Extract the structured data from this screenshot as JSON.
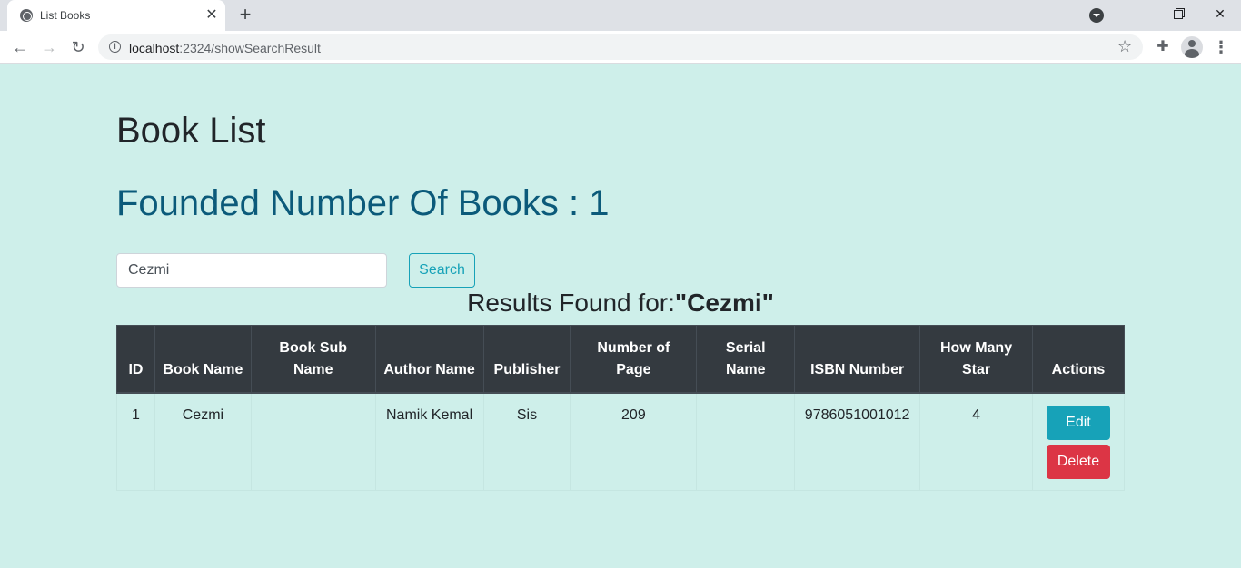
{
  "browser": {
    "tab_title": "List Books",
    "url_host": "localhost",
    "url_path": ":2324/showSearchResult",
    "icons": {
      "favicon": "globe-icon",
      "close": "close-icon",
      "new_tab": "plus-icon",
      "back": "back-arrow-icon",
      "forward": "forward-arrow-icon",
      "reload": "reload-icon",
      "info": "info-icon",
      "bookmark": "star-icon",
      "extensions": "puzzle-icon",
      "profile": "avatar",
      "menu": "kebab-menu-icon"
    }
  },
  "page": {
    "title": "Book List",
    "found_label": "Founded Number Of Books : 1",
    "search": {
      "value": "Cezmi",
      "button_label": "Search"
    },
    "results_prefix": "Results Found for:",
    "results_query": "\"Cezmi\"",
    "table": {
      "headers": [
        "ID",
        "Book Name",
        "Book Sub Name",
        "Author Name",
        "Publisher",
        "Number of Page",
        "Serial Name",
        "ISBN Number",
        "How Many Star",
        "Actions"
      ],
      "rows": [
        {
          "id": "1",
          "book_name": "Cezmi",
          "sub_name": "",
          "author": "Namik Kemal",
          "publisher": "Sis",
          "pages": "209",
          "serial": "",
          "isbn": "9786051001012",
          "stars": "4",
          "edit_label": "Edit",
          "delete_label": "Delete"
        }
      ]
    },
    "colors": {
      "background": "#ceefea",
      "heading_blue": "#0b5a7a",
      "table_header": "#343a40",
      "edit": "#17a2b8",
      "delete": "#dc3545"
    }
  }
}
